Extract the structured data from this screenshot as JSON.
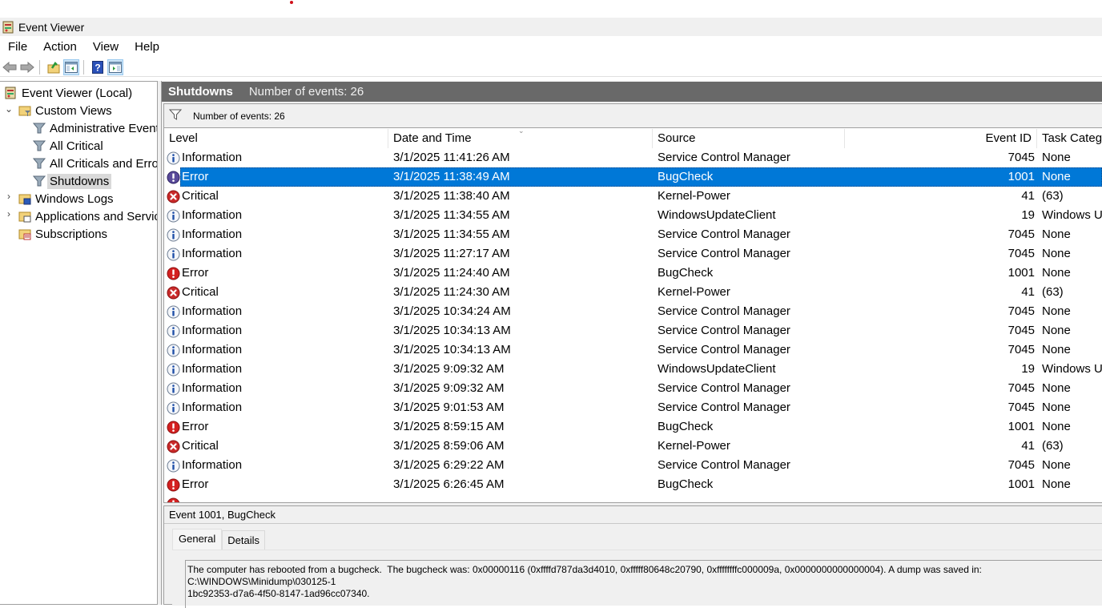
{
  "window": {
    "title": "Event Viewer"
  },
  "menu": {
    "items": [
      "File",
      "Action",
      "View",
      "Help"
    ]
  },
  "toolbar": {
    "buttons": [
      "back",
      "forward",
      "up-folder",
      "show-hide-console-tree",
      "help",
      "show-hide-action-pane"
    ]
  },
  "tree": {
    "root": "Event Viewer (Local)",
    "custom_views": "Custom Views",
    "custom_children": [
      "Administrative Events",
      "All Critical",
      "All Criticals and Errors",
      "Shutdowns"
    ],
    "selected": "Shutdowns",
    "windows_logs": "Windows Logs",
    "apps_services": "Applications and Services Logs",
    "subscriptions": "Subscriptions"
  },
  "main": {
    "title": "Shutdowns",
    "count_label": "Number of events: 26",
    "filter_label": "Number of events: 26",
    "columns": [
      "Level",
      "Date and Time",
      "Source",
      "Event ID",
      "Task Category"
    ],
    "rows": [
      {
        "level": "Information",
        "date": "3/1/2025 11:41:26 AM",
        "source": "Service Control Manager",
        "id": "7045",
        "task": "None"
      },
      {
        "level": "Error",
        "date": "3/1/2025 11:38:49 AM",
        "source": "BugCheck",
        "id": "1001",
        "task": "None",
        "selected": true
      },
      {
        "level": "Critical",
        "date": "3/1/2025 11:38:40 AM",
        "source": "Kernel-Power",
        "id": "41",
        "task": "(63)"
      },
      {
        "level": "Information",
        "date": "3/1/2025 11:34:55 AM",
        "source": "WindowsUpdateClient",
        "id": "19",
        "task": "Windows Update Agent"
      },
      {
        "level": "Information",
        "date": "3/1/2025 11:34:55 AM",
        "source": "Service Control Manager",
        "id": "7045",
        "task": "None"
      },
      {
        "level": "Information",
        "date": "3/1/2025 11:27:17 AM",
        "source": "Service Control Manager",
        "id": "7045",
        "task": "None"
      },
      {
        "level": "Error",
        "date": "3/1/2025 11:24:40 AM",
        "source": "BugCheck",
        "id": "1001",
        "task": "None"
      },
      {
        "level": "Critical",
        "date": "3/1/2025 11:24:30 AM",
        "source": "Kernel-Power",
        "id": "41",
        "task": "(63)"
      },
      {
        "level": "Information",
        "date": "3/1/2025 10:34:24 AM",
        "source": "Service Control Manager",
        "id": "7045",
        "task": "None"
      },
      {
        "level": "Information",
        "date": "3/1/2025 10:34:13 AM",
        "source": "Service Control Manager",
        "id": "7045",
        "task": "None"
      },
      {
        "level": "Information",
        "date": "3/1/2025 10:34:13 AM",
        "source": "Service Control Manager",
        "id": "7045",
        "task": "None"
      },
      {
        "level": "Information",
        "date": "3/1/2025 9:09:32 AM",
        "source": "WindowsUpdateClient",
        "id": "19",
        "task": "Windows Update Agent"
      },
      {
        "level": "Information",
        "date": "3/1/2025 9:09:32 AM",
        "source": "Service Control Manager",
        "id": "7045",
        "task": "None"
      },
      {
        "level": "Information",
        "date": "3/1/2025 9:01:53 AM",
        "source": "Service Control Manager",
        "id": "7045",
        "task": "None"
      },
      {
        "level": "Error",
        "date": "3/1/2025 8:59:15 AM",
        "source": "BugCheck",
        "id": "1001",
        "task": "None"
      },
      {
        "level": "Critical",
        "date": "3/1/2025 8:59:06 AM",
        "source": "Kernel-Power",
        "id": "41",
        "task": "(63)"
      },
      {
        "level": "Information",
        "date": "3/1/2025 6:29:22 AM",
        "source": "Service Control Manager",
        "id": "7045",
        "task": "None"
      },
      {
        "level": "Error",
        "date": "3/1/2025 6:26:45 AM",
        "source": "BugCheck",
        "id": "1001",
        "task": "None"
      }
    ]
  },
  "detail": {
    "title": "Event 1001, BugCheck",
    "tabs": [
      "General",
      "Details"
    ],
    "active_tab": "General",
    "description": "The computer has rebooted from a bugcheck.  The bugcheck was: 0x00000116 (0xffffd787da3d4010, 0xfffff80648c20790, 0xffffffffc000009a, 0x0000000000000004). A dump was saved in: C:\\WINDOWS\\Minidump\\030125-1\n1bc92353-d7a6-4f50-8147-1ad96cc07340."
  },
  "colors": {
    "selection": "#0078d7",
    "header_bg": "#696969",
    "info_icon": "#1f4fa8",
    "error_icon": "#d42020",
    "critical_icon": "#c92a2a"
  }
}
